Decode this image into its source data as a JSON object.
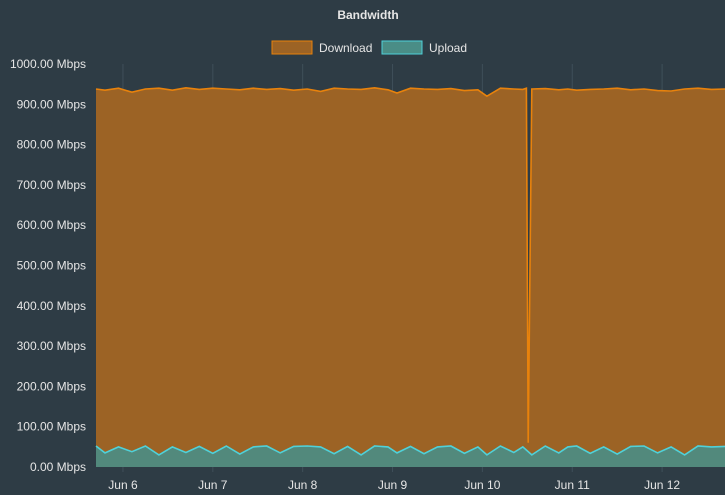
{
  "chart_data": {
    "type": "area",
    "title": "Bandwidth",
    "xlabel": "",
    "ylabel": "",
    "y_tick_labels": [
      "0.00 Mbps",
      "100.00 Mbps",
      "200.00 Mbps",
      "300.00 Mbps",
      "400.00 Mbps",
      "500.00 Mbps",
      "600.00 Mbps",
      "700.00 Mbps",
      "800.00 Mbps",
      "900.00 Mbps",
      "1000.00 Mbps"
    ],
    "y_ticks": [
      0,
      100,
      200,
      300,
      400,
      500,
      600,
      700,
      800,
      900,
      1000
    ],
    "ylim": [
      0,
      1000
    ],
    "x_tick_labels": [
      "Jun 6",
      "Jun 7",
      "Jun 8",
      "Jun 9",
      "Jun 10",
      "Jun 11",
      "Jun 12"
    ],
    "x_ticks": [
      6,
      7,
      8,
      9,
      10,
      11,
      12
    ],
    "xlim": [
      5.7,
      12.7
    ],
    "legend_position": "top",
    "grid": true,
    "series": [
      {
        "name": "Download",
        "color": "#e8820c",
        "fill": "#9c6325",
        "x": [
          5.7,
          5.8,
          5.95,
          6.1,
          6.25,
          6.4,
          6.55,
          6.7,
          6.85,
          7.0,
          7.15,
          7.3,
          7.45,
          7.6,
          7.75,
          7.9,
          8.05,
          8.2,
          8.35,
          8.5,
          8.65,
          8.8,
          8.95,
          9.05,
          9.2,
          9.35,
          9.5,
          9.65,
          9.8,
          9.95,
          10.05,
          10.2,
          10.35,
          10.45,
          10.49,
          10.51,
          10.55,
          10.7,
          10.85,
          10.95,
          11.05,
          11.2,
          11.35,
          11.5,
          11.65,
          11.8,
          11.95,
          12.1,
          12.25,
          12.4,
          12.55,
          12.7
        ],
        "values": [
          938,
          935,
          940,
          930,
          938,
          940,
          935,
          941,
          937,
          940,
          938,
          936,
          940,
          937,
          939,
          935,
          938,
          932,
          940,
          938,
          937,
          941,
          936,
          928,
          940,
          938,
          937,
          939,
          934,
          936,
          920,
          940,
          938,
          937,
          940,
          60,
          938,
          939,
          936,
          938,
          935,
          937,
          938,
          940,
          936,
          938,
          934,
          933,
          938,
          940,
          937,
          938
        ]
      },
      {
        "name": "Upload",
        "color": "#4fd1d9",
        "fill": "#4a8d86",
        "x": [
          5.7,
          5.8,
          5.95,
          6.1,
          6.25,
          6.4,
          6.55,
          6.7,
          6.85,
          7.0,
          7.15,
          7.3,
          7.45,
          7.6,
          7.75,
          7.9,
          8.05,
          8.2,
          8.35,
          8.5,
          8.65,
          8.8,
          8.95,
          9.05,
          9.2,
          9.35,
          9.5,
          9.65,
          9.8,
          9.95,
          10.05,
          10.2,
          10.35,
          10.45,
          10.55,
          10.7,
          10.85,
          10.95,
          11.05,
          11.2,
          11.35,
          11.5,
          11.65,
          11.8,
          11.95,
          12.1,
          12.25,
          12.4,
          12.55,
          12.7
        ],
        "values": [
          52,
          35,
          50,
          38,
          52,
          30,
          50,
          36,
          51,
          34,
          52,
          32,
          50,
          52,
          35,
          51,
          52,
          50,
          33,
          51,
          30,
          52,
          50,
          35,
          51,
          33,
          50,
          52,
          34,
          50,
          30,
          52,
          36,
          50,
          30,
          52,
          35,
          50,
          52,
          34,
          50,
          32,
          51,
          52,
          35,
          50,
          30,
          52,
          50,
          51
        ]
      }
    ]
  }
}
